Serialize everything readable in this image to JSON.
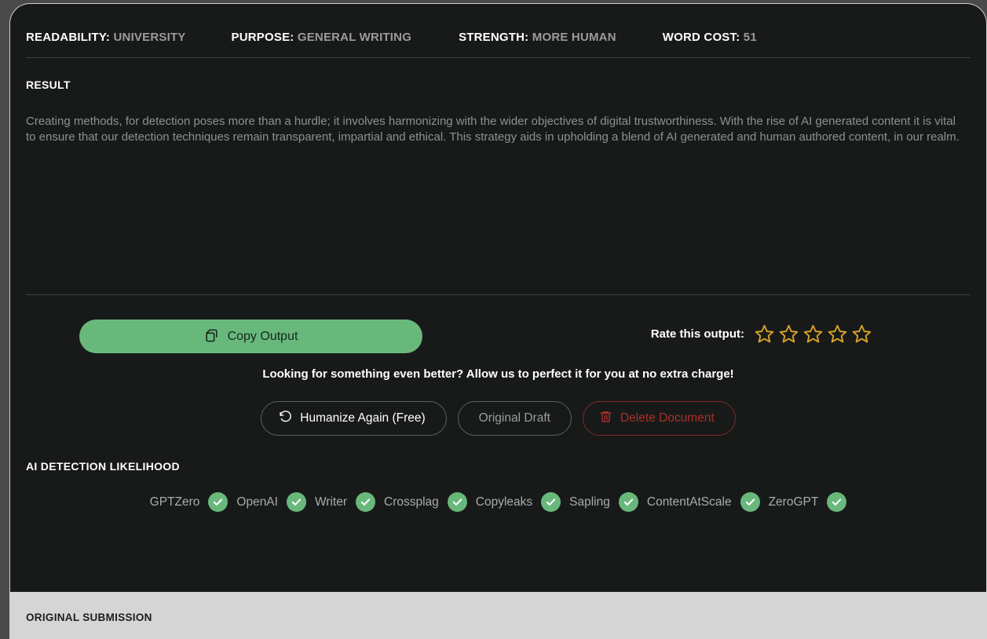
{
  "meta": {
    "items": [
      {
        "label": "READABILITY:",
        "value": "UNIVERSITY"
      },
      {
        "label": "PURPOSE:",
        "value": "GENERAL WRITING"
      },
      {
        "label": "STRENGTH:",
        "value": "MORE HUMAN"
      },
      {
        "label": "WORD COST:",
        "value": "51"
      }
    ]
  },
  "result": {
    "title": "RESULT",
    "body": "Creating methods, for detection poses more than a hurdle; it involves harmonizing with the wider objectives of digital trustworthiness. With the rise of AI generated content it is vital to ensure that our detection techniques remain transparent, impartial and ethical. This strategy aids in upholding a blend of AI generated and human authored content, in our realm."
  },
  "actions": {
    "copy_label": "Copy Output",
    "copy_icon": "copy-icon",
    "rate_label": "Rate this output:",
    "star_count": 5,
    "stars_filled": 0,
    "promo": "Looking for something even better? Allow us to perfect it for you at no extra charge!",
    "humanize_label": "Humanize Again (Free)",
    "humanize_icon": "history-icon",
    "original_label": "Original Draft",
    "delete_label": "Delete Document",
    "delete_icon": "trash-icon"
  },
  "detection": {
    "title": "AI DETECTION LIKELIHOOD",
    "detectors": [
      {
        "name": "GPTZero",
        "status": "pass"
      },
      {
        "name": "OpenAI",
        "status": "pass"
      },
      {
        "name": "Writer",
        "status": "pass"
      },
      {
        "name": "Crossplag",
        "status": "pass"
      },
      {
        "name": "Copyleaks",
        "status": "pass"
      },
      {
        "name": "Sapling",
        "status": "pass"
      },
      {
        "name": "ContentAtScale",
        "status": "pass"
      },
      {
        "name": "ZeroGPT",
        "status": "pass"
      }
    ]
  },
  "original_submission": {
    "title": "ORIGINAL SUBMISSION"
  },
  "colors": {
    "accent_green": "#68b87c",
    "star_gold": "#d8a326",
    "danger_red": "#a8302c",
    "card_bg": "#181a19",
    "page_bg": "#4a4a4a",
    "panel_bg": "#d5d5d5"
  }
}
